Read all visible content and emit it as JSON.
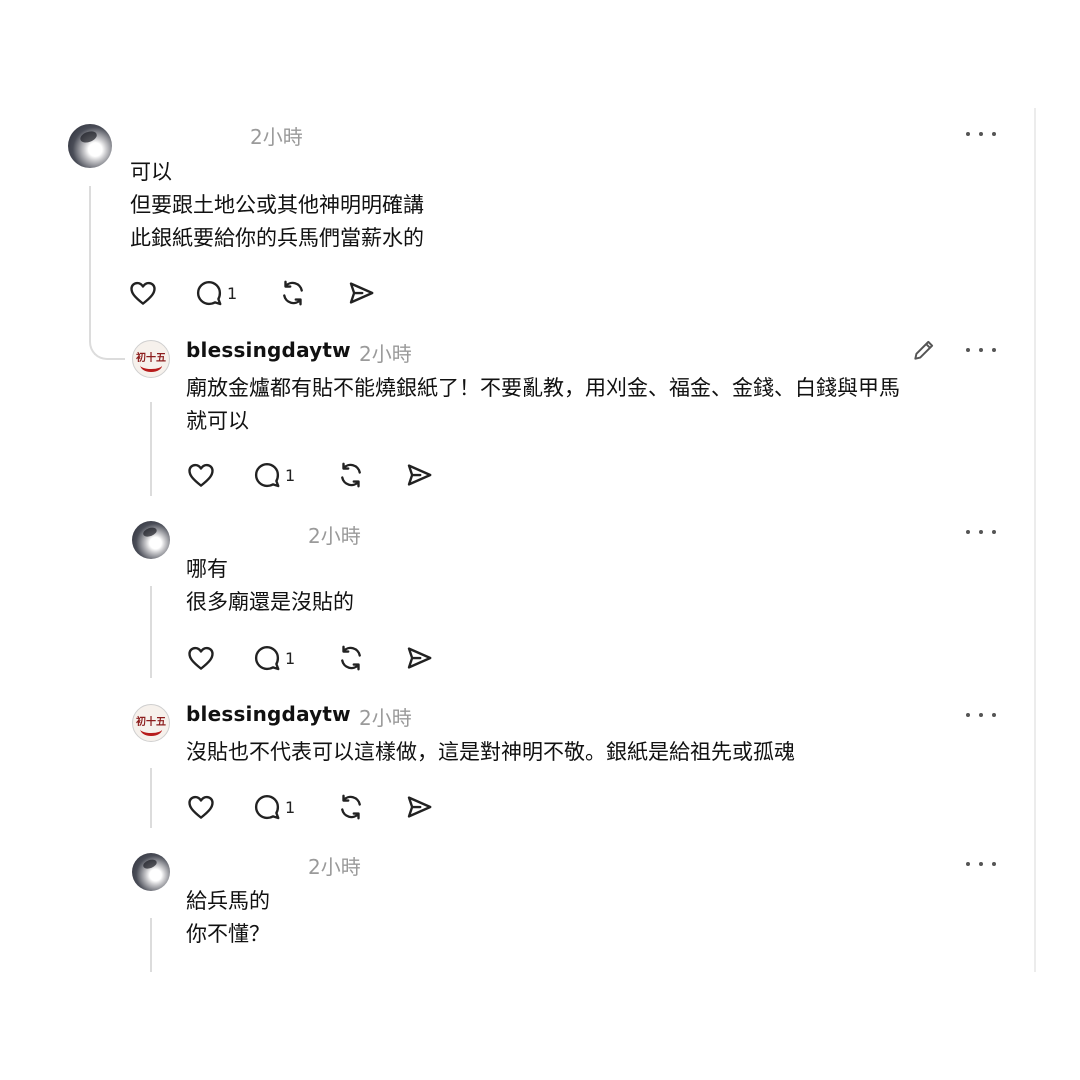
{
  "colors": {
    "line": "#dcdcdc",
    "muted": "#9a9a9a",
    "text": "#111111"
  },
  "icons": [
    "heart-icon",
    "reply-icon",
    "repost-icon",
    "share-icon",
    "more-icon",
    "edit-icon"
  ],
  "posts": [
    {
      "name": "",
      "time": "2小時",
      "lines": [
        "可以",
        "但要跟土地公或其他神明明確講",
        "此銀紙要給你的兵馬們當薪水的"
      ],
      "reply_count": "1"
    },
    {
      "name": "blessingdaytw",
      "avatar_text": "初十五",
      "time": "2小時",
      "lines": [
        "廟放金爐都有貼不能燒銀紙了！不要亂教，用刈金、福金、金錢、白錢與甲馬",
        "就可以"
      ],
      "reply_count": "1"
    },
    {
      "name": "",
      "time": "2小時",
      "lines": [
        "哪有",
        "很多廟還是沒貼的"
      ],
      "reply_count": "1"
    },
    {
      "name": "blessingdaytw",
      "avatar_text": "初十五",
      "time": "2小時",
      "lines": [
        "沒貼也不代表可以這樣做，這是對神明不敬。銀紙是給祖先或孤魂"
      ],
      "reply_count": "1"
    },
    {
      "name": "",
      "time": "2小時",
      "lines": [
        "給兵馬的",
        "你不懂？"
      ]
    }
  ]
}
